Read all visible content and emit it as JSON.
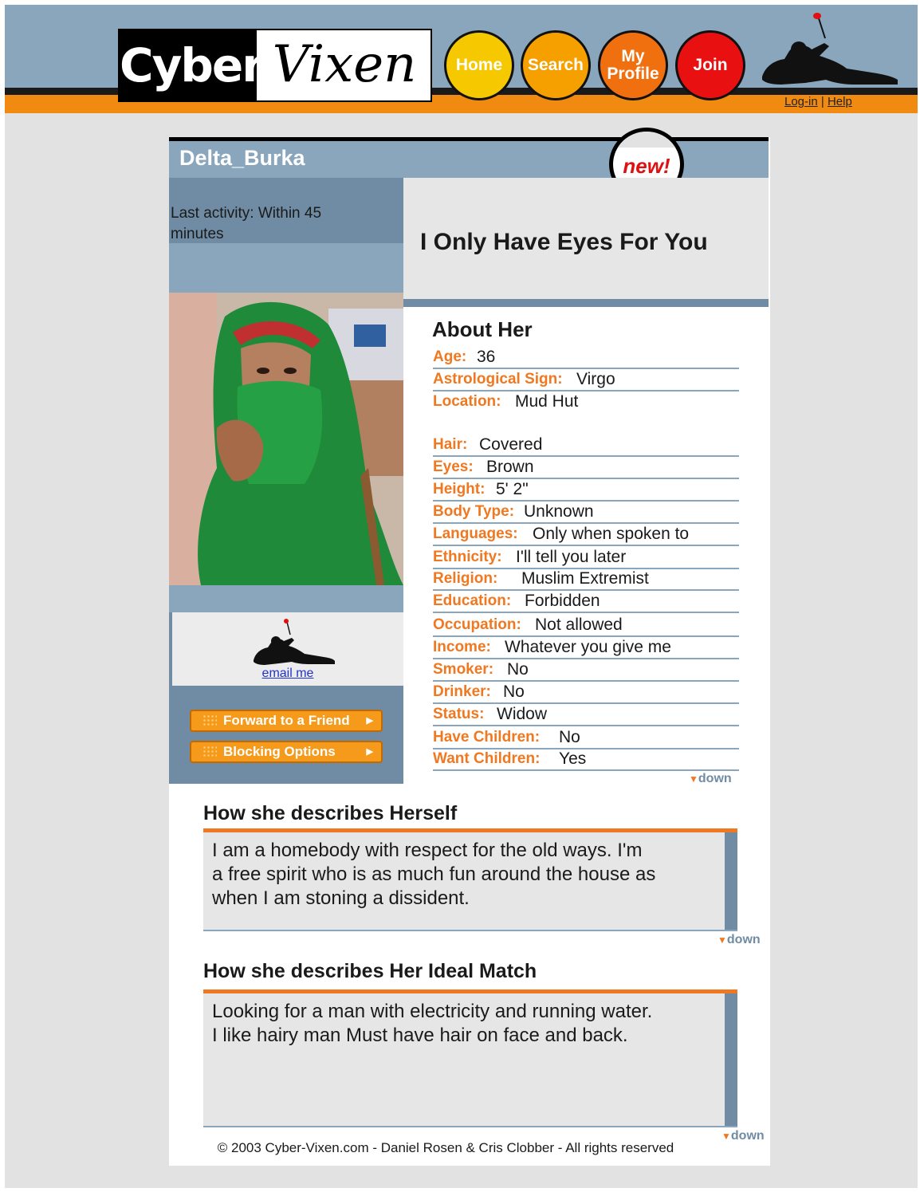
{
  "header": {
    "logo_part1": "Cyber",
    "logo_part2": "Vixen",
    "nav": [
      {
        "label": "Home",
        "color": "#f6c800"
      },
      {
        "label": "Search",
        "color": "#f6a000"
      },
      {
        "label": "My Profile",
        "color": "#f07010"
      },
      {
        "label": "Join",
        "color": "#e81010"
      }
    ],
    "login_link": "Log-in",
    "separator": "|",
    "help_link": "Help"
  },
  "profile": {
    "username": "Delta_Burka",
    "new_badge": "new!",
    "last_activity": "Last activity: Within 45 minutes",
    "headline": "I Only Have Eyes For You",
    "email_link": "email me",
    "forward_button": "Forward to a Friend",
    "blocking_button": "Blocking Options"
  },
  "about": {
    "title": "About Her",
    "fields": [
      {
        "label": "Age:",
        "value": "36"
      },
      {
        "label": "Astrological Sign:",
        "value": "Virgo"
      },
      {
        "label": "Location:",
        "value": "Mud Hut"
      },
      {
        "label": "Hair:",
        "value": "Covered"
      },
      {
        "label": "Eyes:",
        "value": "Brown"
      },
      {
        "label": "Height:",
        "value": "5' 2\""
      },
      {
        "label": "Body Type:",
        "value": "Unknown"
      },
      {
        "label": "Languages:",
        "value": "Only when spoken to"
      },
      {
        "label": "Ethnicity:",
        "value": "I'll tell you later"
      },
      {
        "label": "Religion:",
        "value": "Muslim Extremist"
      },
      {
        "label": "Education:",
        "value": "Forbidden"
      },
      {
        "label": "Occupation:",
        "value": "Not allowed"
      },
      {
        "label": "Income:",
        "value": "Whatever you give me"
      },
      {
        "label": "Smoker:",
        "value": "No"
      },
      {
        "label": "Drinker:",
        "value": "No"
      },
      {
        "label": "Status:",
        "value": "Widow"
      },
      {
        "label": "Have Children:",
        "value": "No"
      },
      {
        "label": "Want Children:",
        "value": "Yes"
      }
    ],
    "down_label": "down"
  },
  "herself": {
    "title": "How she describes Herself",
    "text": "I am a homebody with respect for the old ways.  I'm\na free spirit who is as much fun around the house as\nwhen I am stoning a dissident.",
    "down_label": "down"
  },
  "ideal_match": {
    "title": "How she describes Her Ideal Match",
    "text": "Looking for a man with electricity and running water.\nI like hairy man    Must have hair on face and back.",
    "down_label": "down"
  },
  "footer": {
    "copyright": "© 2003 Cyber-Vixen.com - Daniel Rosen & Cris Clobber - All rights reserved"
  },
  "colors": {
    "accent_orange": "#f07820",
    "steel_blue": "#8aa6bc",
    "dark_steel": "#6f8ca4"
  }
}
